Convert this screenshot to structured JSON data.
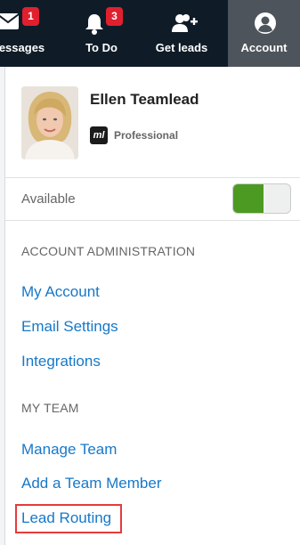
{
  "nav": {
    "messages": {
      "label": "Messages",
      "badge": "1"
    },
    "todo": {
      "label": "To Do",
      "badge": "3"
    },
    "leads": {
      "label": "Get leads"
    },
    "account": {
      "label": "Account"
    }
  },
  "profile": {
    "name": "Ellen Teamlead",
    "plan_logo": "ml",
    "plan": "Professional"
  },
  "availability": {
    "label": "Available",
    "on": true
  },
  "sections": [
    {
      "heading": "ACCOUNT ADMINISTRATION",
      "links": [
        "My Account",
        "Email Settings",
        "Integrations"
      ]
    },
    {
      "heading": "MY TEAM",
      "links": [
        "Manage Team",
        "Add a Team Member",
        "Lead Routing"
      ]
    }
  ],
  "highlighted_link": "Lead Routing",
  "colors": {
    "nav_bg": "#0f1c28",
    "account_tab_bg": "#4d545c",
    "badge": "#e0202e",
    "link": "#1778c9",
    "toggle_on": "#4c9a22",
    "highlight": "#e53b3b"
  },
  "icons": {
    "messages": "envelope-icon",
    "todo": "bell-icon",
    "leads": "add-person-icon",
    "account": "user-circle-icon"
  }
}
